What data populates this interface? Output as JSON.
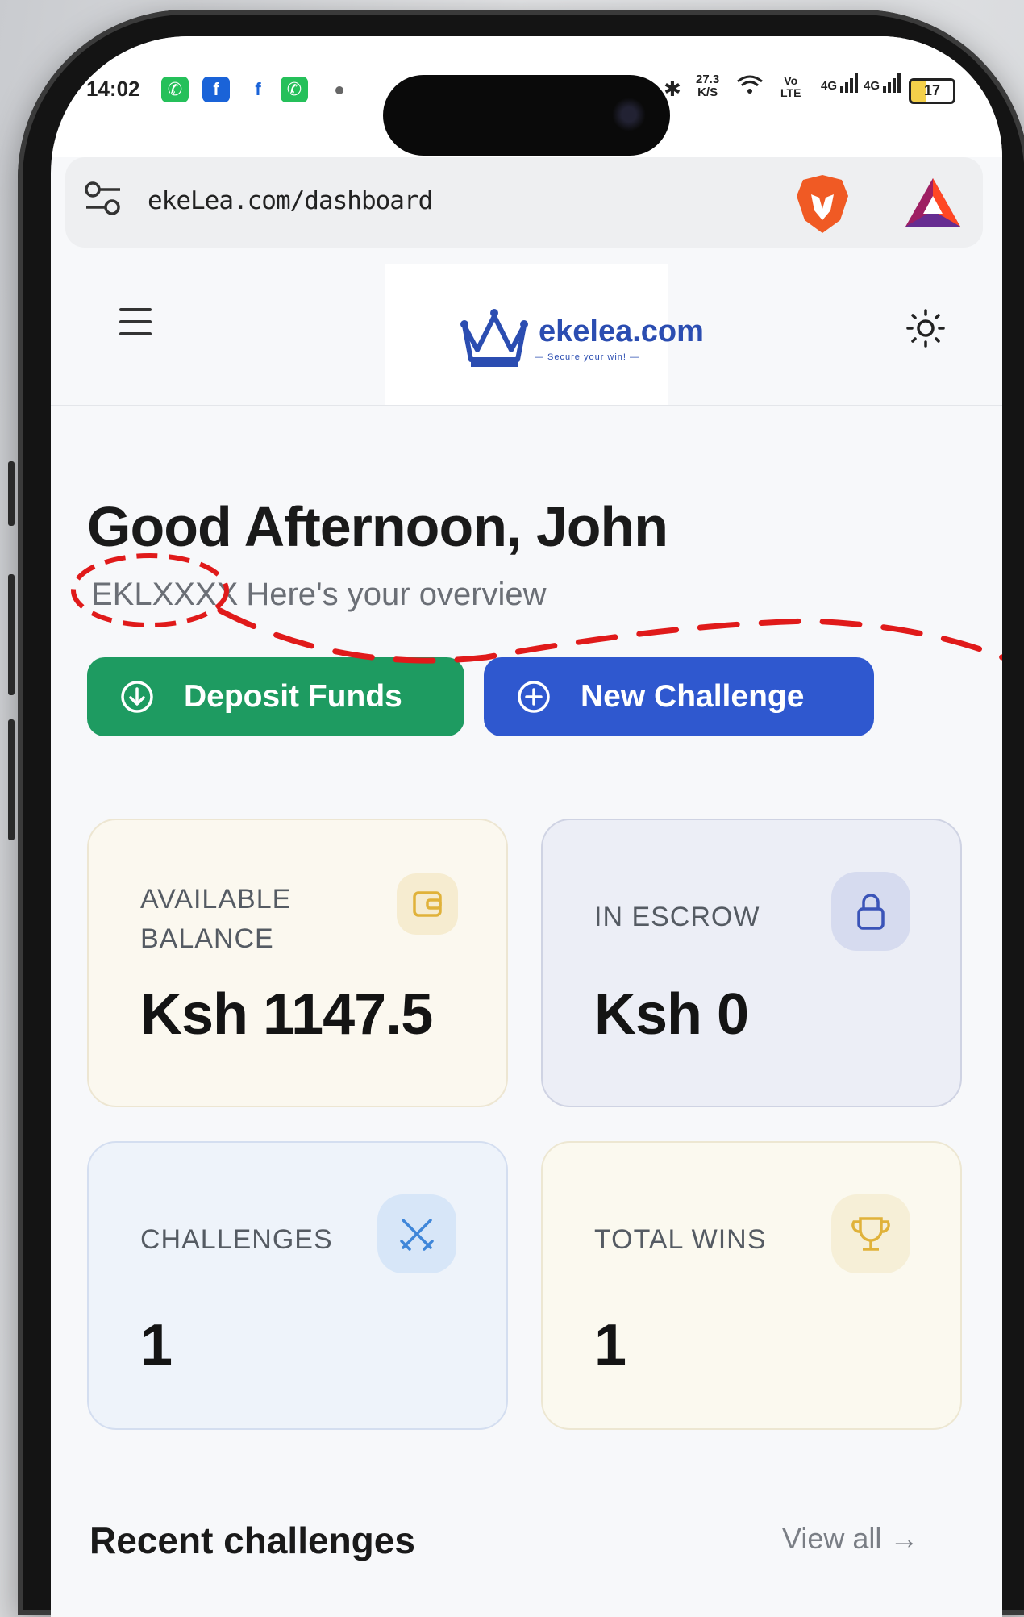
{
  "status_bar": {
    "time": "14:02",
    "net_speed_value": "27.3",
    "net_speed_unit": "K/S",
    "volte_top": "Vo",
    "volte_bottom": "LTE",
    "signal1": "4G",
    "signal2": "4G",
    "battery": "17",
    "apps": [
      "whatsapp-icon",
      "facebook-square-icon",
      "facebook-icon",
      "whatsapp-icon"
    ]
  },
  "browser": {
    "url": "ekeLea.com/dashboard"
  },
  "header": {
    "logo_text": "ekelea.com",
    "logo_tagline": "— Secure your win! —"
  },
  "greeting": {
    "title": "Good Afternoon, John",
    "user_code": "EKLXXXX",
    "subtitle": "Here's your overview"
  },
  "actions": {
    "deposit": "Deposit Funds",
    "new_challenge": "New Challenge"
  },
  "stats": {
    "available_label_1": "AVAILABLE",
    "available_label_2": "BALANCE",
    "available_value": "Ksh 1147.5",
    "escrow_label": "IN ESCROW",
    "escrow_value": "Ksh 0",
    "challenges_label": "CHALLENGES",
    "challenges_value": "1",
    "wins_label": "TOTAL WINS",
    "wins_value": "1"
  },
  "recent": {
    "title": "Recent challenges",
    "view_all": "View all →"
  },
  "colors": {
    "deposit": "#1e9b61",
    "challenge": "#2f58cf",
    "brand": "#2b4db1",
    "annotation": "#e01a1a"
  }
}
